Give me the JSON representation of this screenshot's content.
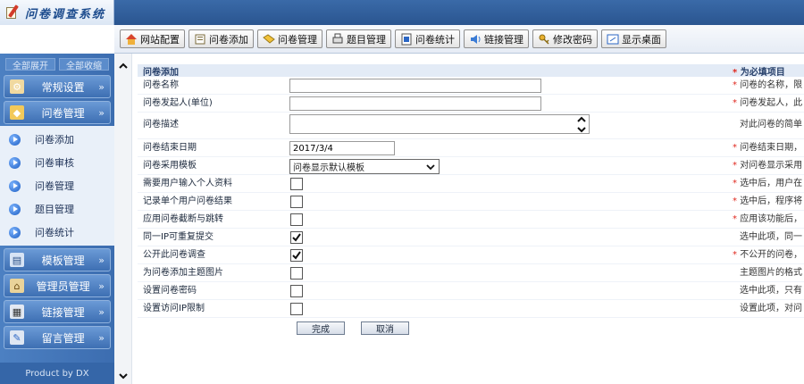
{
  "app": {
    "title": "问卷调查系统"
  },
  "toolbar": {
    "buttons": [
      {
        "label": "网站配置",
        "icon": "home-icon"
      },
      {
        "label": "问卷添加",
        "icon": "book-icon"
      },
      {
        "label": "问卷管理",
        "icon": "folder-icon"
      },
      {
        "label": "题目管理",
        "icon": "printer-icon"
      },
      {
        "label": "问卷统计",
        "icon": "chart-icon"
      },
      {
        "label": "链接管理",
        "icon": "speaker-icon"
      },
      {
        "label": "修改密码",
        "icon": "key-icon"
      },
      {
        "label": "显示桌面",
        "icon": "desktop-icon"
      }
    ]
  },
  "sidebar": {
    "expand_all": "全部展开",
    "collapse_all": "全部收缩",
    "categories": [
      {
        "label": "常规设置",
        "icon": "settings-icon"
      },
      {
        "label": "问卷管理",
        "icon": "survey-icon"
      }
    ],
    "survey_items": [
      {
        "label": "问卷添加"
      },
      {
        "label": "问卷审核"
      },
      {
        "label": "问卷管理"
      },
      {
        "label": "题目管理"
      },
      {
        "label": "问卷统计"
      }
    ],
    "lower_categories": [
      {
        "label": "模板管理",
        "icon": "template-icon"
      },
      {
        "label": "管理员管理",
        "icon": "admin-icon"
      },
      {
        "label": "链接管理",
        "icon": "link-icon"
      },
      {
        "label": "留言管理",
        "icon": "message-icon"
      }
    ],
    "footer": "Product by DX"
  },
  "form": {
    "header": "问卷添加",
    "required_note": "为必填项目",
    "required_star": "*",
    "fields": {
      "name": {
        "label": "问卷名称",
        "value": "",
        "hint": "问卷的名称，限"
      },
      "sponsor": {
        "label": "问卷发起人(单位)",
        "value": "",
        "hint": "问卷发起人，此"
      },
      "description": {
        "label": "问卷描述",
        "value": "",
        "hint": "对此问卷的简单"
      },
      "end_date": {
        "label": "问卷结束日期",
        "value": "2017/3/4",
        "hint": "问卷结束日期，"
      },
      "template": {
        "label": "问卷采用模板",
        "value": "问卷显示默认模板",
        "hint": "对问卷显示采用"
      },
      "require_info": {
        "label": "需要用户输入个人资料",
        "checked": false,
        "hint": "选中后，用户在"
      },
      "record_result": {
        "label": "记录单个用户问卷结果",
        "checked": false,
        "hint": "选中后，程序将"
      },
      "cut_jump": {
        "label": "应用问卷截断与跳转",
        "checked": false,
        "hint": "应用该功能后，"
      },
      "ip_repeat": {
        "label": "同一IP可重复提交",
        "checked": true,
        "hint": "选中此项，同一"
      },
      "public_survey": {
        "label": "公开此问卷调查",
        "checked": true,
        "hint": "不公开的问卷，"
      },
      "topic_image": {
        "label": "为问卷添加主题图片",
        "checked": false,
        "hint": "主题图片的格式"
      },
      "password": {
        "label": "设置问卷密码",
        "checked": false,
        "hint": "选中此项，只有"
      },
      "ip_limit": {
        "label": "设置访问IP限制",
        "checked": false,
        "hint": "设置此项，对问"
      }
    },
    "submit_label": "完成",
    "cancel_label": "取消"
  },
  "colors": {
    "topbar": "#2a5590",
    "sidebar": "#3c6db0",
    "required": "#e0281e"
  }
}
